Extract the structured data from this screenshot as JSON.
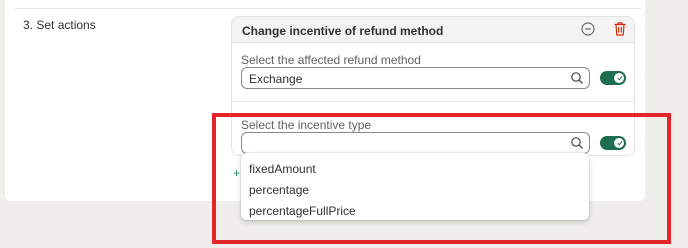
{
  "step": {
    "label": "3. Set actions"
  },
  "action": {
    "title": "Change incentive of refund method",
    "refund_method": {
      "label": "Select the affected refund method",
      "value": "Exchange",
      "toggle_on": true
    },
    "incentive": {
      "label": "Select the incentive type",
      "value": "",
      "toggle_on": true
    }
  },
  "add_button": {
    "label": "+"
  },
  "dropdown": {
    "options": [
      "fixedAmount",
      "percentage",
      "percentageFullPrice"
    ]
  },
  "colors": {
    "toggle": "#1f6d4f",
    "delete": "#d72c0d",
    "highlight": "#e4262b",
    "background": "#efeeea"
  },
  "icons": [
    "minus-circle-icon",
    "trash-icon",
    "search-icon",
    "check-icon"
  ]
}
